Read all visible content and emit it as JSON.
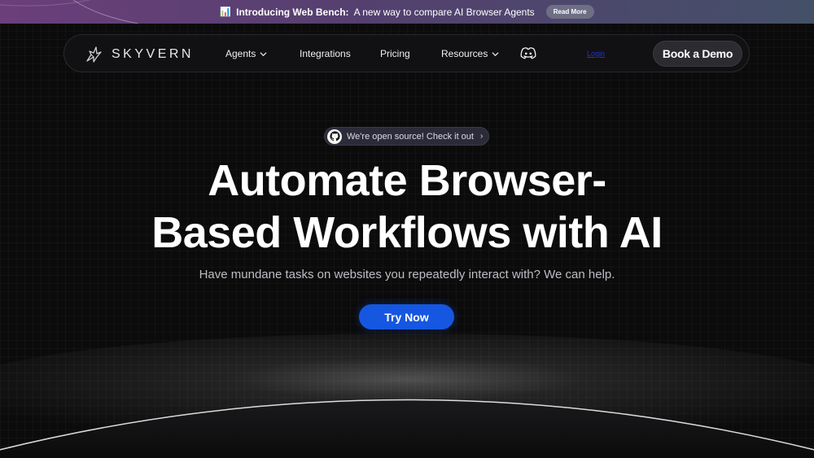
{
  "announcement": {
    "emoji": "📊",
    "highlight": "Introducing Web Bench:",
    "text": "A new way to compare AI Browser Agents",
    "button": "Read More"
  },
  "nav": {
    "logo_text": "SKYVERN",
    "items": [
      {
        "label": "Agents",
        "has_dropdown": true
      },
      {
        "label": "Integrations",
        "has_dropdown": false
      },
      {
        "label": "Pricing",
        "has_dropdown": false
      },
      {
        "label": "Resources",
        "has_dropdown": true
      }
    ],
    "discord_icon": "discord-icon",
    "login_label": "Login",
    "demo_button": "Book a Demo"
  },
  "hero": {
    "badge_text": "We're open source! Check it out",
    "badge_icon": "github-icon",
    "headline_line1": "Automate Browser-",
    "headline_line2": "Based Workflows with AI",
    "subtitle": "Have mundane tasks on websites you repeatedly interact with? We can help.",
    "cta": "Try Now"
  },
  "colors": {
    "background": "#0b0b0c",
    "cta_blue": "#1557e0",
    "announce_start": "#6b3f7a",
    "announce_end": "#445068"
  }
}
